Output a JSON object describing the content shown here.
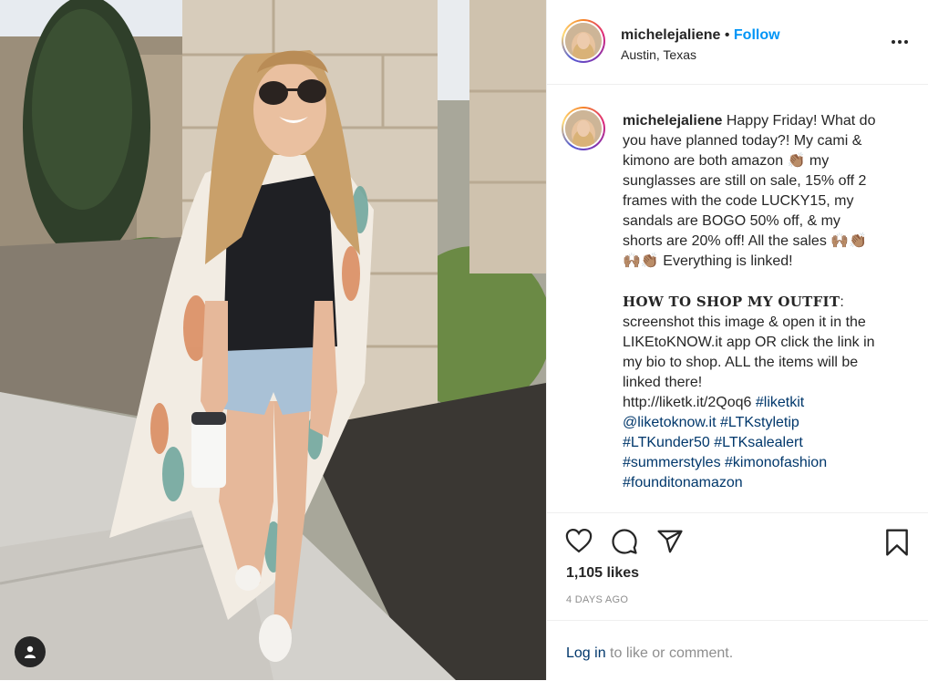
{
  "post": {
    "username": "michelejaliene",
    "separator": "•",
    "follow_label": "Follow",
    "location": "Austin, Texas",
    "caption_line1": "Happy Friday! What do\nyou have planned today?! My cami &\nkimono are both amazon ",
    "caption_line2": " my\nsunglasses are still on sale, 15% off 2\nframes with the code LUCKY15, my\nsandals are BOGO 50% off, & my\nshorts are 20% off! All the sales ",
    "caption_line3": " Everything is linked!\n\n",
    "emoji_clap": "👏🏽",
    "emoji_raise": "🙌🏽",
    "howto_heading": "HOW TO SHOP MY OUTFIT",
    "howto_colon": ":",
    "howto_text": "\nscreenshot this image & open it in the\nLIKEtoKNOW.it app OR click the link in\nmy bio to shop. ALL the items will be\nlinked there!\nhttp://liketk.it/2Qoq6 ",
    "tags": [
      "#liketkit",
      "@liketoknow.it",
      "#LTKstyletip",
      "#LTKunder50",
      "#LTKsalealert",
      "#summerstyles",
      "#kimonofashion",
      "#founditonamazon"
    ],
    "likes_text": "1,105 likes",
    "date_text": "4 DAYS AGO",
    "login_link": "Log in",
    "login_rest": " to like or comment."
  },
  "icons": [
    "heart-icon",
    "comment-icon",
    "share-icon",
    "bookmark-icon",
    "more-options-icon",
    "user-tag-icon"
  ],
  "colors": {
    "follow_blue": "#0095f6",
    "link": "#00376b",
    "meta_gray": "#8e8e8e"
  }
}
